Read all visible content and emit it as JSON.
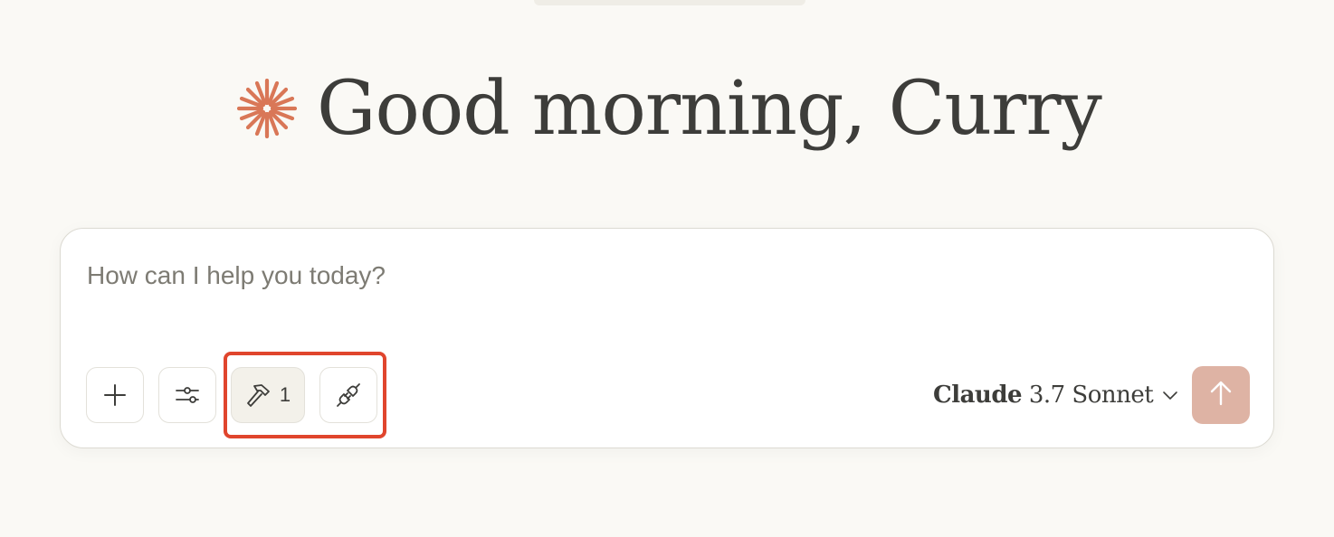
{
  "greeting": {
    "text": "Good morning, Curry",
    "logo_icon": "sparkle-burst-icon",
    "logo_color": "#d97757"
  },
  "composer": {
    "placeholder": "How can I help you today?",
    "value": ""
  },
  "toolbar": {
    "add_icon": "plus-icon",
    "settings_icon": "sliders-icon",
    "tools_icon": "hammer-icon",
    "tools_count": "1",
    "connect_icon": "plug-icon"
  },
  "model_selector": {
    "brand": "Claude",
    "model": "3.7 Sonnet",
    "chevron_icon": "chevron-down-icon"
  },
  "send": {
    "icon": "arrow-up-icon",
    "accent_color": "#deb3a4"
  },
  "highlight": {
    "color": "#e0452d"
  }
}
